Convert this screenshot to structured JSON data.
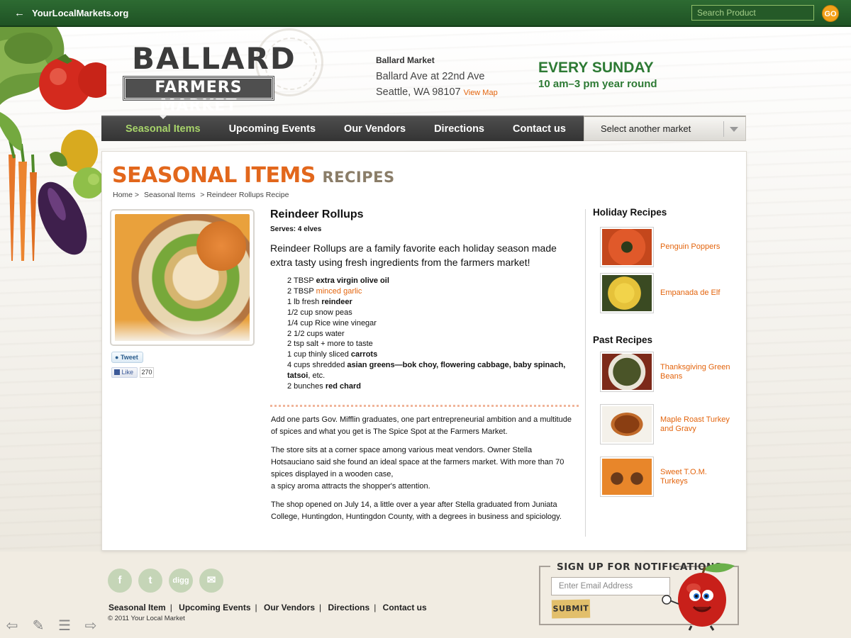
{
  "topbar": {
    "back_label": "YourLocalMarkets.org",
    "search_placeholder": "Search Product",
    "go_label": "GO"
  },
  "header": {
    "logo_top": "BALLARD",
    "logo_bottom": "FARMERS MARKET",
    "market_name": "Ballard Market",
    "address_line1": "Ballard Ave at 22nd Ave",
    "address_line2": "Seattle, WA 98107",
    "view_map": "View Map",
    "schedule_day": "EVERY SUNDAY",
    "schedule_time": "10 am–3 pm year round"
  },
  "nav": {
    "items": [
      {
        "label": "Seasonal Items",
        "active": true
      },
      {
        "label": "Upcoming Events"
      },
      {
        "label": "Our Vendors"
      },
      {
        "label": "Directions"
      },
      {
        "label": "Contact us"
      }
    ],
    "market_select": "Select another market"
  },
  "page": {
    "section_title": "SEASONAL ITEMS",
    "section_subtitle": "RECIPES",
    "breadcrumb": [
      "Home >",
      "Seasonal Items",
      "> Reindeer Rollups Recipe"
    ],
    "tweet_label": "Tweet",
    "like_label": "Like",
    "like_count": "270"
  },
  "recipe": {
    "title": "Reindeer Rollups",
    "serves": "Serves: 4 elves",
    "intro": "Reindeer Rollups are a family favorite each holiday season made extra tasty using fresh ingredients from the farmers market!",
    "ingredients": [
      {
        "qty": "2 TBSP ",
        "item": "extra virgin olive oil",
        "style": "bold"
      },
      {
        "qty": "2 TBSP ",
        "item": "minced garlic",
        "style": "link"
      },
      {
        "qty": "1 lb fresh ",
        "item": "reindeer",
        "style": "bold"
      },
      {
        "qty": "1/2 cup snow peas",
        "item": "",
        "style": ""
      },
      {
        "qty": "1/4 cup Rice wine vinegar",
        "item": "",
        "style": ""
      },
      {
        "qty": "2 1/2 cups water",
        "item": "",
        "style": ""
      },
      {
        "qty": "2 tsp salt + more to taste",
        "item": "",
        "style": ""
      },
      {
        "qty": "1 cup thinly sliced ",
        "item": "carrots",
        "style": "bold"
      },
      {
        "qty": "4 cups shredded ",
        "item": "asian greens—bok choy, flowering cabbage, baby spinach, tatsoi",
        "style": "bold",
        "suffix": ", etc."
      },
      {
        "qty": "2 bunches ",
        "item": "red chard",
        "style": "bold"
      }
    ],
    "story": [
      "Add one parts Gov. Mifflin graduates, one part entrepreneurial ambition and a multitude of spices and what you get is The Spice Spot at the Farmers Market.",
      "The store sits at a corner space among various meat vendors. Owner Stella Hotsauciano said she found an ideal space at the farmers market. With more than 70 spices displayed in a wooden case,",
      "a spicy aroma attracts the shopper's attention.",
      "The shop opened on July 14, a little over a year after Stella graduated from Juniata College, Huntingdon, Huntingdon County, with a degrees in business and spiciology."
    ]
  },
  "sidebar": {
    "holiday_heading": "Holiday Recipes",
    "holiday": [
      {
        "label": "Penguin Poppers",
        "color": "#e0592a"
      },
      {
        "label": "Empanada de Elf",
        "color": "#e6c23a"
      }
    ],
    "past_heading": "Past Recipes",
    "past": [
      {
        "label": "Thanksgiving Green Beans",
        "color": "#5e6a3a"
      },
      {
        "label": "Maple Roast Turkey and Gravy",
        "color": "#a5561f"
      },
      {
        "label": "Sweet T.O.M. Turkeys",
        "color": "#e8862a"
      }
    ]
  },
  "footer": {
    "social": [
      {
        "name": "facebook-icon",
        "glyph": "f"
      },
      {
        "name": "twitter-icon",
        "glyph": "t"
      },
      {
        "name": "digg-icon",
        "glyph": "digg"
      },
      {
        "name": "email-icon",
        "glyph": "✉"
      }
    ],
    "links": [
      "Seasonal Item",
      "Upcoming Events",
      "Our Vendors",
      "Directions",
      "Contact us"
    ],
    "copyright": "© 2011 Your Local Market",
    "signup_title": "SIGN UP FOR NOTIFICATIONS",
    "email_placeholder": "Enter Email Address",
    "submit_label": "SUBMIT"
  },
  "colors": {
    "accent_orange": "#e2671c",
    "brand_green": "#2d7a34",
    "nav_active": "#a7d36a"
  }
}
